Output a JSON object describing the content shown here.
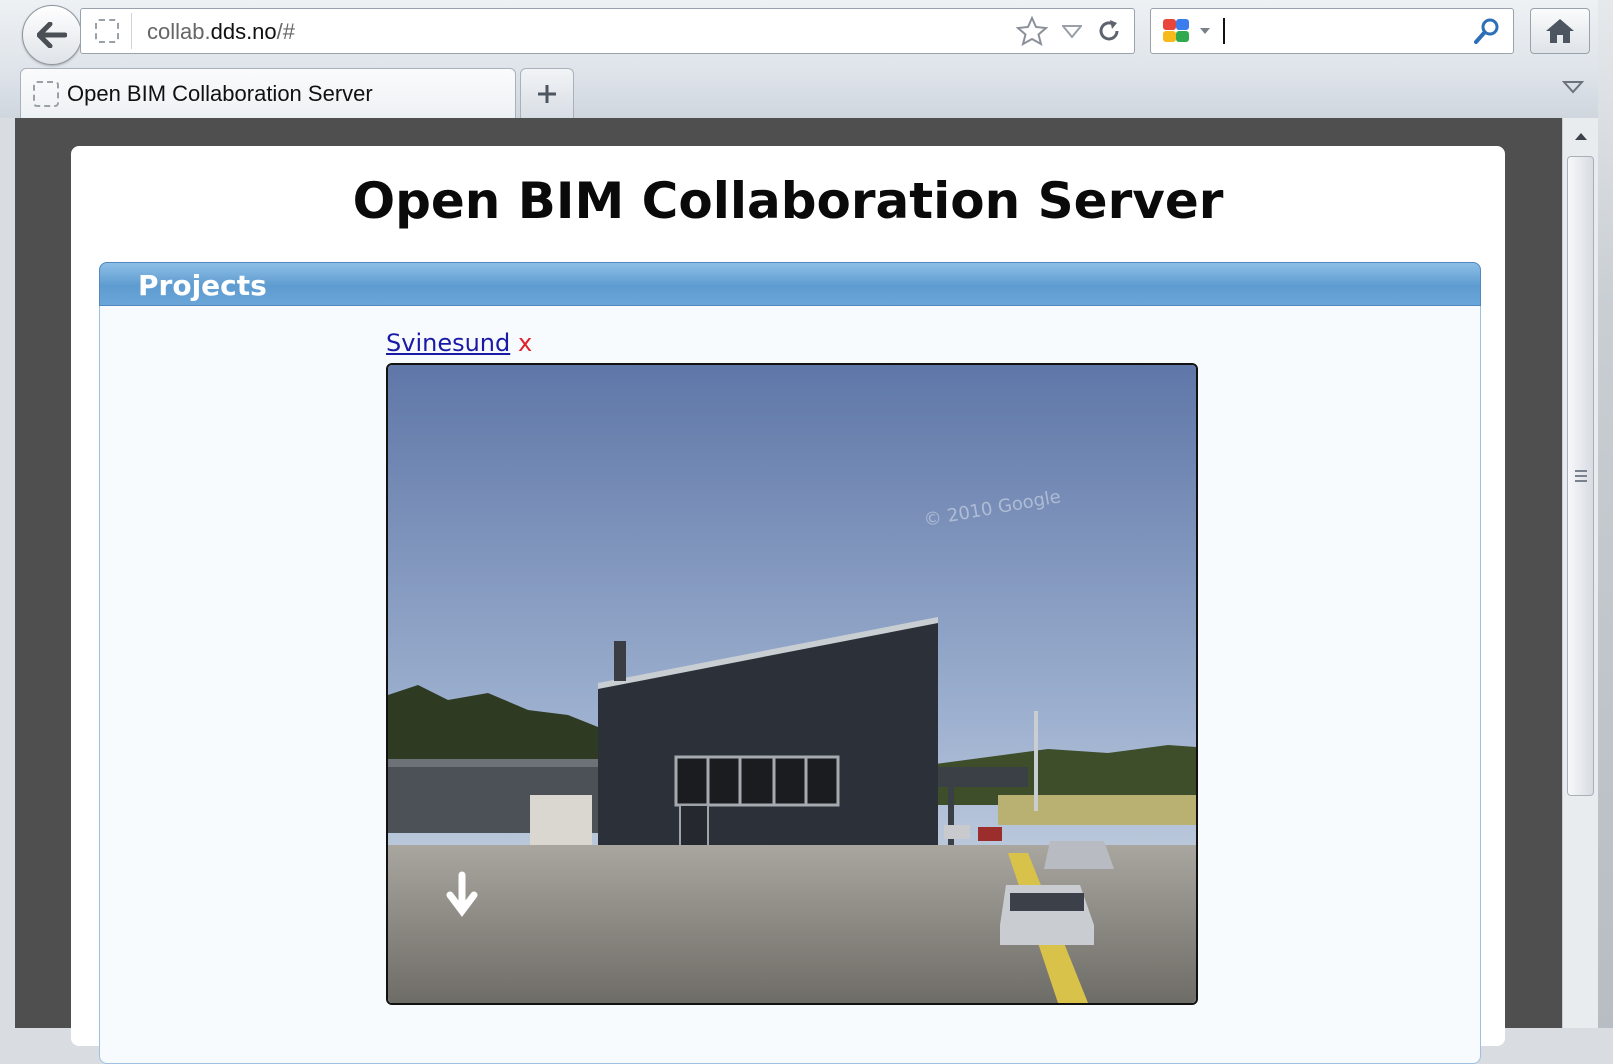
{
  "browser": {
    "url_prefix": "collab.",
    "url_domain": "dds.no",
    "url_suffix": "/#",
    "search_value": "",
    "tab_title": "Open BIM Collaboration Server",
    "new_tab_label": "+",
    "accent_color": "#5e9bd0"
  },
  "icons": {
    "back": "arrow-left-icon",
    "site": "page-icon",
    "bookmark": "star-icon",
    "history": "dropdown-icon",
    "reload": "reload-icon",
    "search_engine": "google-icon",
    "search_go": "magnifier-icon",
    "home": "home-icon",
    "tab_list": "chevron-down-icon"
  },
  "page": {
    "title": "Open BIM Collaboration Server",
    "panel_title": "Projects",
    "projects": [
      {
        "name": "Svinesund",
        "delete_label": "x"
      }
    ]
  }
}
